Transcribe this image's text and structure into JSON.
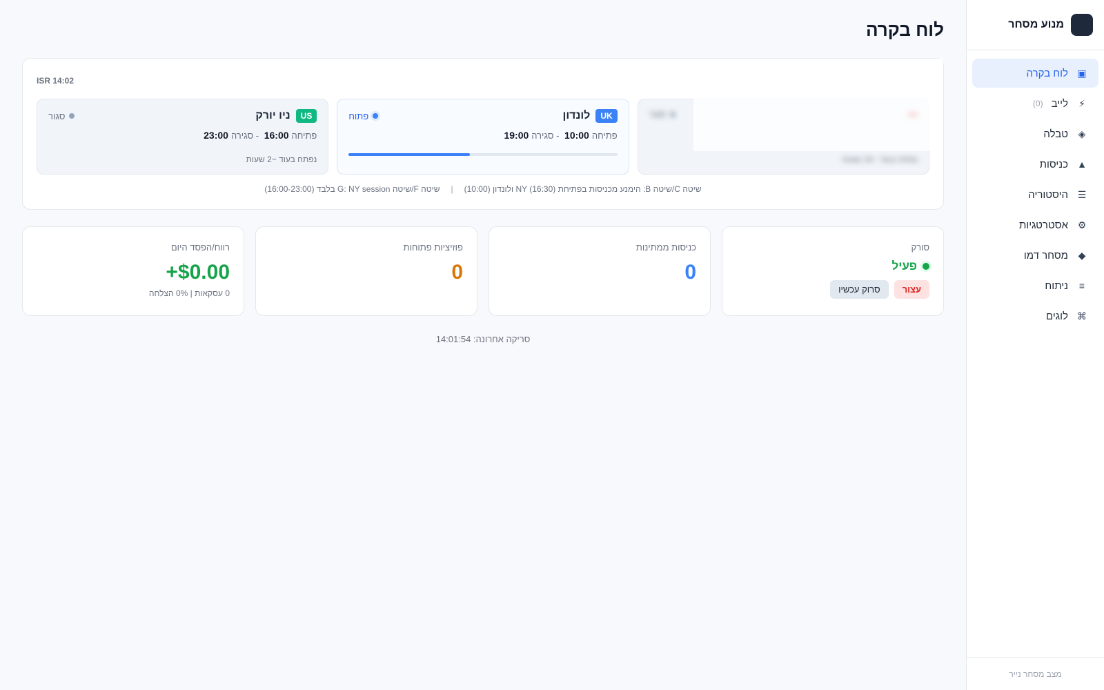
{
  "sidebar": {
    "brand": "מנוע מסחר",
    "items": [
      {
        "label": "לוח בקרה",
        "icon": "dashboard-icon",
        "glyph": "▣",
        "active": true
      },
      {
        "label": "לייב",
        "icon": "lightning-icon",
        "glyph": "⚡",
        "count": "(0)"
      },
      {
        "label": "טבלה",
        "icon": "table-icon",
        "glyph": "◈"
      },
      {
        "label": "כניסות",
        "icon": "triangle-icon",
        "glyph": "▲"
      },
      {
        "label": "היסטוריה",
        "icon": "list-icon",
        "glyph": "☰"
      },
      {
        "label": "אסטרטגיות",
        "icon": "gear-icon",
        "glyph": "⚙"
      },
      {
        "label": "מסחר דמו",
        "icon": "diamond-icon",
        "glyph": "◆"
      },
      {
        "label": "ניתוח",
        "icon": "bars-icon",
        "glyph": "≡"
      },
      {
        "label": "לוגים",
        "icon": "command-icon",
        "glyph": "⌘"
      }
    ],
    "footer": "מצב מסחר נייר"
  },
  "page": {
    "title": "לוח בקרה"
  },
  "markets_panel": {
    "title": "",
    "clock": "ISR 14:02",
    "open_label": "פתיחה",
    "close_label": "סגירה",
    "markets": [
      {
        "code": "",
        "name": "",
        "status": "סגור",
        "open": "",
        "close": "",
        "note": "נפתח בעוד ~14 שעות",
        "state": "closed",
        "blurred": true,
        "badge_color": "#ef4444"
      },
      {
        "code": "UK",
        "name": "לונדון",
        "status": "פתוח",
        "open": "10:00",
        "close": "19:00",
        "note": "",
        "state": "open",
        "blurred": false,
        "badge_color": "#3b82f6",
        "progress": 0.45
      },
      {
        "code": "US",
        "name": "ניו יורק",
        "status": "סגור",
        "open": "16:00",
        "close": "23:00",
        "note": "נפתח בעוד ~2 שעות",
        "state": "closed",
        "blurred": false,
        "badge_color": "#10b981"
      }
    ],
    "footnote_a": "שיטה C/שיטה B: הימנע מכניסות בפתיחת NY (16:30) ולונדון (10:00)",
    "footnote_sep": "|",
    "footnote_b": "שיטה F/שיטה G: NY session בלבד (16:00-23:00)"
  },
  "stats": {
    "scanner": {
      "label": "סורק",
      "state": "פעיל",
      "stop": "עצור",
      "scan_now": "סרוק עכשיו"
    },
    "pending": {
      "label": "כניסות ממתינות",
      "value": "0"
    },
    "positions": {
      "label": "פוזיציות פתוחות",
      "value": "0"
    },
    "pnl": {
      "label": "רווח/הפסד היום",
      "value": "+$0.00",
      "sub": "0 עסקאות | 0% הצלחה"
    }
  },
  "last_scan": "סריקה אחרונה: 14:01:54",
  "colors": {
    "accent": "#2563eb",
    "success": "#16a34a",
    "warning": "#d97706",
    "danger": "#dc2626"
  }
}
